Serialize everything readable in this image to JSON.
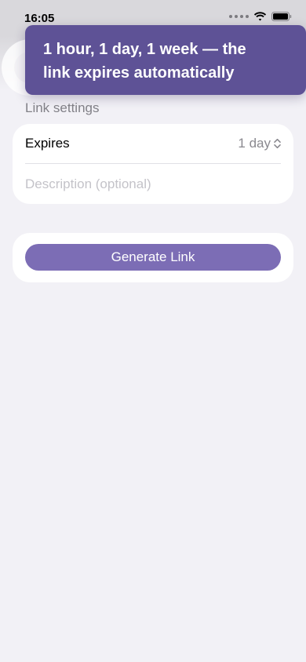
{
  "status_bar": {
    "time": "16:05",
    "icons": [
      "cellular-dots-icon",
      "wifi-icon",
      "battery-icon"
    ]
  },
  "tooltip": {
    "text_line1": "1 hour, 1 day, 1 week — the",
    "text_line2": "link expires automatically",
    "background_color": "#5e5296"
  },
  "link_settings": {
    "header": "Link settings",
    "expires": {
      "label": "Expires",
      "value": "1 day",
      "icon": "chevron-up-down-icon"
    },
    "description": {
      "value": "",
      "placeholder": "Description (optional)"
    }
  },
  "actions": {
    "generate_label": "Generate Link",
    "accent_color": "#7c6db5"
  }
}
